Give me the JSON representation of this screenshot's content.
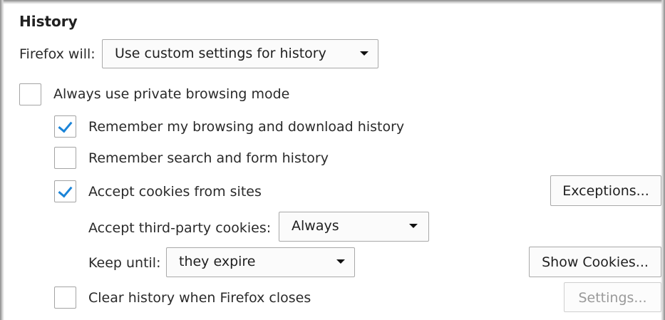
{
  "section": {
    "title": "History"
  },
  "history_mode": {
    "label": "Firefox will:",
    "selected": "Use custom settings for history"
  },
  "private_browsing": {
    "label": "Always use private browsing mode",
    "checked": false
  },
  "remember_history": {
    "label": "Remember my browsing and download history",
    "checked": true
  },
  "remember_search": {
    "label": "Remember search and form history",
    "checked": false
  },
  "accept_cookies": {
    "label": "Accept cookies from sites",
    "checked": true,
    "exceptions_button": "Exceptions..."
  },
  "third_party": {
    "label": "Accept third-party cookies:",
    "selected": "Always"
  },
  "keep_until": {
    "label": "Keep until:",
    "selected": "they expire",
    "show_cookies_button": "Show Cookies..."
  },
  "clear_history": {
    "label": "Clear history when Firefox closes",
    "checked": false,
    "settings_button": "Settings..."
  },
  "colors": {
    "accent": "#1b84d8",
    "border": "#a9a9a9",
    "disabled_text": "#9a9a9a"
  }
}
